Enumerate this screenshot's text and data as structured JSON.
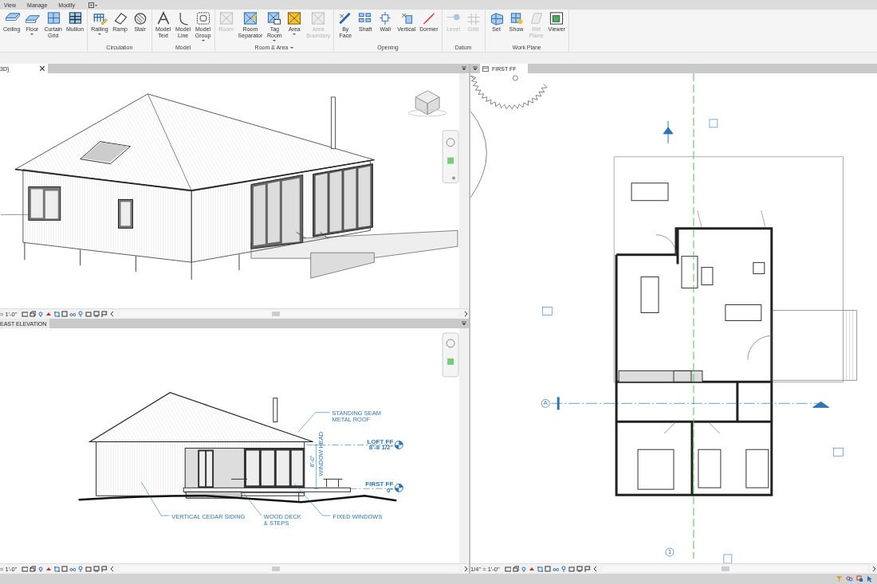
{
  "menu_tabs": [
    {
      "label": "View"
    },
    {
      "label": "Manage"
    },
    {
      "label": "Modify"
    }
  ],
  "ribbon": [
    {
      "tools": [
        {
          "label": "Ceiling",
          "disabled": false,
          "dropdown": false
        },
        {
          "label": "Floor",
          "disabled": false,
          "dropdown": true
        },
        {
          "label": "Curtain Grid",
          "disabled": false,
          "dropdown": false
        },
        {
          "label": "Mullion",
          "disabled": false,
          "dropdown": false
        }
      ]
    },
    {
      "title": "Circulation",
      "menu": false,
      "tools": [
        {
          "label": "Railing",
          "disabled": false,
          "dropdown": true
        },
        {
          "label": "Ramp",
          "disabled": false,
          "dropdown": false
        },
        {
          "label": "Stair",
          "disabled": false,
          "dropdown": false
        }
      ]
    },
    {
      "title": "Model",
      "menu": false,
      "tools": [
        {
          "label": "Model Text",
          "disabled": false,
          "dropdown": false
        },
        {
          "label": "Model Line",
          "disabled": false,
          "dropdown": false
        },
        {
          "label": "Model Group",
          "disabled": false,
          "dropdown": true
        }
      ]
    },
    {
      "title": "Room & Area",
      "menu": true,
      "tools": [
        {
          "label": "Room",
          "disabled": true,
          "dropdown": false
        },
        {
          "label": "Room Separator",
          "disabled": false,
          "dropdown": false
        },
        {
          "label": "Tag Room",
          "disabled": false,
          "dropdown": true
        },
        {
          "label": "Area",
          "disabled": false,
          "dropdown": true
        },
        {
          "label": "Area Boundary",
          "disabled": true,
          "dropdown": false
        }
      ]
    },
    {
      "title": "Opening",
      "menu": false,
      "tools": [
        {
          "label": "By Face",
          "disabled": false,
          "dropdown": false
        },
        {
          "label": "Shaft",
          "disabled": false,
          "dropdown": false
        },
        {
          "label": "Wall",
          "disabled": false,
          "dropdown": false
        },
        {
          "label": "Vertical",
          "disabled": false,
          "dropdown": false
        },
        {
          "label": "Dormer",
          "disabled": false,
          "dropdown": false
        }
      ]
    },
    {
      "title": "Datum",
      "menu": false,
      "tools": [
        {
          "label": "Level",
          "disabled": true,
          "dropdown": false
        },
        {
          "label": "Grid",
          "disabled": true,
          "dropdown": false
        }
      ]
    },
    {
      "title": "Work Plane",
      "menu": false,
      "tools": [
        {
          "label": "Set",
          "disabled": false,
          "dropdown": false
        },
        {
          "label": "Show",
          "disabled": false,
          "dropdown": false
        },
        {
          "label": "Ref Plane",
          "disabled": true,
          "dropdown": false
        },
        {
          "label": "Viewer",
          "disabled": false,
          "dropdown": false
        }
      ]
    }
  ],
  "views": [
    {
      "kind": "perspective",
      "tab": "3D}",
      "closable": true,
      "scale": "= 1'-0\""
    },
    {
      "kind": "elevation",
      "tab": "EAST ELEVATION",
      "closable": false,
      "scale": "= 1'-0\"",
      "callouts": [
        {
          "lines": [
            "STANDING SEAM",
            "METAL ROOF"
          ]
        },
        {
          "lines": [
            "VERTICAL CEDAR SIDING"
          ]
        },
        {
          "lines": [
            "WOOD DECK",
            "& STEPS"
          ]
        },
        {
          "lines": [
            "FIXED WINDOWS"
          ]
        }
      ],
      "levels": [
        {
          "name": "LOFT FF",
          "elevation": "8'-8 1/2\""
        },
        {
          "name": "FIRST FF",
          "elevation": "0\""
        }
      ],
      "dimension": {
        "value": "8'-0\"",
        "label": "WINDOW HEAD"
      }
    },
    {
      "kind": "plan",
      "tab": "FIRST FF",
      "closable": false,
      "scale": "1/4\" = 1'-0\"",
      "grid_bubbles": [
        "A",
        "1"
      ]
    }
  ]
}
